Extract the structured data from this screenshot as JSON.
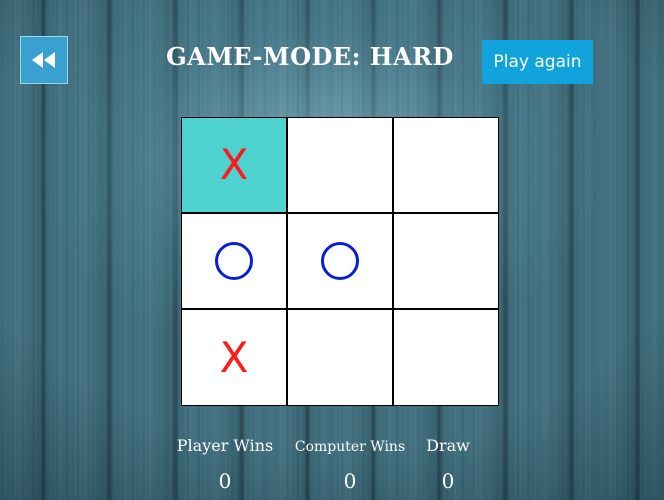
{
  "header": {
    "back_icon": "rewind-icon",
    "title": "GAME-MODE: HARD",
    "play_again_label": "Play again"
  },
  "board": {
    "cells": [
      "X",
      "",
      "",
      "O",
      "O",
      "",
      "X",
      "",
      ""
    ],
    "highlighted_cell": 0,
    "highlight_color": "#4dd2d0",
    "x_color": "#ff1a1a",
    "o_color": "#0a1ed8"
  },
  "stats": {
    "player_wins_label": "Player Wins",
    "player_wins": "0",
    "computer_wins_label": "Computer Wins",
    "computer_wins": "0",
    "draw_label": "Draw",
    "draw": "0"
  }
}
